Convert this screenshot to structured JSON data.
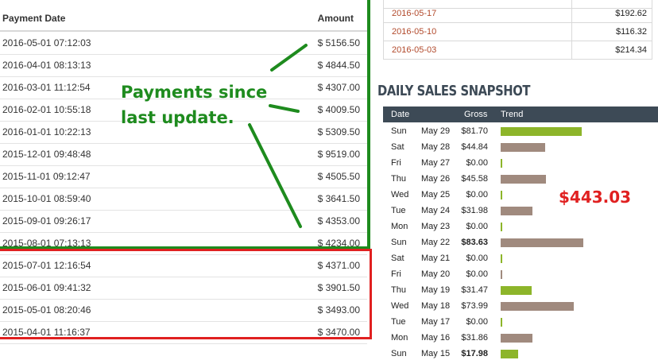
{
  "payments": {
    "headers": {
      "date": "Payment Date",
      "amount": "Amount"
    },
    "rows": [
      {
        "date": "2016-05-01 07:12:03",
        "amount": "$ 5156.50"
      },
      {
        "date": "2016-04-01 08:13:13",
        "amount": "$ 4844.50"
      },
      {
        "date": "2016-03-01 11:12:54",
        "amount": "$ 4307.00"
      },
      {
        "date": "2016-02-01 10:55:18",
        "amount": "$ 4009.50"
      },
      {
        "date": "2016-01-01 10:22:13",
        "amount": "$ 5309.50"
      },
      {
        "date": "2015-12-01 09:48:48",
        "amount": "$ 9519.00"
      },
      {
        "date": "2015-11-01 09:12:47",
        "amount": "$ 4505.50"
      },
      {
        "date": "2015-10-01 08:59:40",
        "amount": "$ 3641.50"
      },
      {
        "date": "2015-09-01 09:26:17",
        "amount": "$ 4353.00"
      },
      {
        "date": "2015-08-01 07:13:13",
        "amount": "$ 4234.00"
      },
      {
        "date": "2015-07-01 12:16:54",
        "amount": "$ 4371.00"
      },
      {
        "date": "2015-06-01 09:41:32",
        "amount": "$ 3901.50"
      },
      {
        "date": "2015-05-01 08:20:46",
        "amount": "$ 3493.00"
      },
      {
        "date": "2015-04-01 11:16:37",
        "amount": "$ 3470.00"
      }
    ]
  },
  "annotation": {
    "line1": "Payments since",
    "line2": "last update.",
    "total": "$443.03",
    "colors": {
      "green": "#1e8b1e",
      "red": "#e02020"
    }
  },
  "recent_table": {
    "rows": [
      {
        "date": "2016-05-17",
        "amount": "$192.62"
      },
      {
        "date": "2016-05-10",
        "amount": "$116.32"
      },
      {
        "date": "2016-05-03",
        "amount": "$214.34"
      }
    ]
  },
  "snapshot": {
    "title": "DAILY SALES SNAPSHOT",
    "headers": {
      "date": "Date",
      "gross": "Gross",
      "trend": "Trend"
    },
    "colors": {
      "header_bg": "#3d4a56",
      "bar_green": "#8db52a",
      "bar_brown": "#a08a7e"
    },
    "rows": [
      {
        "dow": "Sun",
        "date": "May 29",
        "gross": "$81.70",
        "value": 81.7,
        "bold": false,
        "color": "green"
      },
      {
        "dow": "Sat",
        "date": "May 28",
        "gross": "$44.84",
        "value": 44.84,
        "bold": false,
        "color": "brown"
      },
      {
        "dow": "Fri",
        "date": "May 27",
        "gross": "$0.00",
        "value": 0,
        "bold": false,
        "color": "green"
      },
      {
        "dow": "Thu",
        "date": "May 26",
        "gross": "$45.58",
        "value": 45.58,
        "bold": false,
        "color": "brown"
      },
      {
        "dow": "Wed",
        "date": "May 25",
        "gross": "$0.00",
        "value": 0,
        "bold": false,
        "color": "green"
      },
      {
        "dow": "Tue",
        "date": "May 24",
        "gross": "$31.98",
        "value": 31.98,
        "bold": false,
        "color": "brown"
      },
      {
        "dow": "Mon",
        "date": "May 23",
        "gross": "$0.00",
        "value": 0,
        "bold": false,
        "color": "green"
      },
      {
        "dow": "Sun",
        "date": "May 22",
        "gross": "$83.63",
        "value": 83.63,
        "bold": true,
        "color": "brown"
      },
      {
        "dow": "Sat",
        "date": "May 21",
        "gross": "$0.00",
        "value": 0,
        "bold": false,
        "color": "green"
      },
      {
        "dow": "Fri",
        "date": "May 20",
        "gross": "$0.00",
        "value": 0,
        "bold": false,
        "color": "brown"
      },
      {
        "dow": "Thu",
        "date": "May 19",
        "gross": "$31.47",
        "value": 31.47,
        "bold": false,
        "color": "green"
      },
      {
        "dow": "Wed",
        "date": "May 18",
        "gross": "$73.99",
        "value": 73.99,
        "bold": false,
        "color": "brown"
      },
      {
        "dow": "Tue",
        "date": "May 17",
        "gross": "$0.00",
        "value": 0,
        "bold": false,
        "color": "green"
      },
      {
        "dow": "Mon",
        "date": "May 16",
        "gross": "$31.86",
        "value": 31.86,
        "bold": false,
        "color": "brown"
      },
      {
        "dow": "Sun",
        "date": "May 15",
        "gross": "$17.98",
        "value": 17.98,
        "bold": true,
        "color": "green"
      }
    ]
  }
}
